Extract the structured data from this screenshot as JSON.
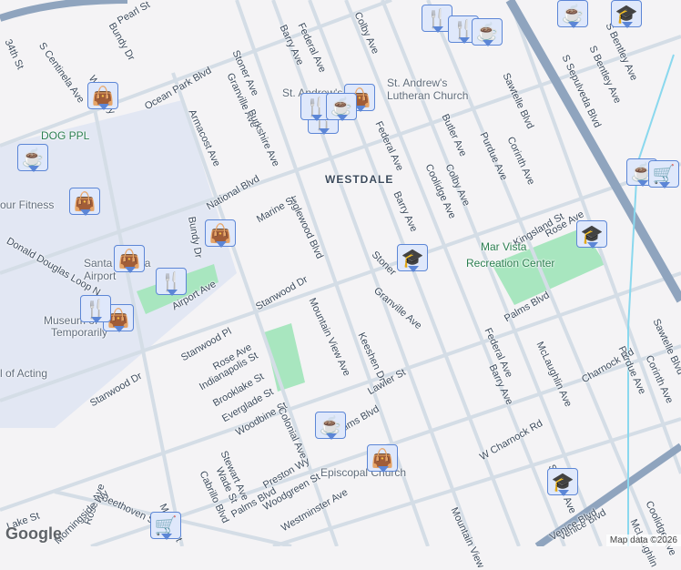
{
  "map": {
    "labels": [
      "Pearl St",
      "34th St",
      "Bundy Dr",
      "S Centinela Ave",
      "Wellesley",
      "Ocean Park Blvd",
      "Stoner Ave",
      "Granville Ave",
      "Barry Ave",
      "Federal Ave",
      "Colby Ave",
      "Armacost Ave",
      "Burkshire Ave",
      "National Blvd",
      "Inglewood Blvd",
      "Marine St",
      "Federal Ave",
      "Barry Ave",
      "Coolidge Ave",
      "Butler Ave",
      "Colby Ave",
      "Purdue Ave",
      "Corinth Ave",
      "Sawtelle Blvd",
      "S Sepulveda Blvd",
      "S Bentley Ave",
      "Kingsland St",
      "Rose Ave",
      "Palms Blvd",
      "McLaughlin Ave",
      "Sawtelle Blvd",
      "Corinth Ave",
      "Purdue Ave",
      "Charnock Rd",
      "Federal Ave",
      "Barry Ave",
      "Granville Ave",
      "Stoner",
      "Keeshen Dr",
      "Lawler St",
      "Mountain View Ave",
      "Stanwood Dr",
      "Bundy Dr",
      "Airport Ave",
      "Donald Douglas Loop N",
      "Stanwood Pl",
      "Rose Ave",
      "Indianapolis St",
      "Brooklake St",
      "Everglade St",
      "Woodbine St",
      "Colonial Ave",
      "Preston Wy",
      "Stewart Ave",
      "Wade St",
      "Cabrillo Blvd",
      "Palms Blvd",
      "Woodgreen St",
      "Westminster Ave",
      "Palms Blvd",
      "W Charnock Rd",
      "S Barry Ave",
      "Mountain View",
      "Venice Blvd",
      "McLaughlin",
      "Coolidge Ave",
      "Beethoven St",
      "Rose Ave",
      "Lake St",
      "Morningside Wy",
      "Stanwood Dr",
      "Moore St",
      "S Bentley Ave",
      "Venice Blvd"
    ],
    "places": [
      "St. Andrew's",
      "Lutheran Church",
      "DOG PPL",
      "WESTDALE",
      "Mar Vista",
      "Recreation Center",
      "Santa Monica",
      "Airport",
      "Museum of",
      "Temporarily",
      "l of Acting",
      "our Fitness",
      "Episcopal Church",
      "St. Andrew's"
    ],
    "attribution": "Map data ©2026",
    "logo": "Google"
  },
  "markers": [
    {
      "type": "shopping",
      "icon": "shopping-bag-icon"
    },
    {
      "type": "shopping",
      "icon": "shopping-bag-icon"
    },
    {
      "type": "shopping",
      "icon": "shopping-bag-icon"
    },
    {
      "type": "shopping",
      "icon": "shopping-bag-icon"
    },
    {
      "type": "shopping",
      "icon": "shopping-bag-icon"
    },
    {
      "type": "shopping",
      "icon": "shopping-bag-icon"
    },
    {
      "type": "shopping",
      "icon": "shopping-bag-icon"
    },
    {
      "type": "restaurant",
      "icon": "fork-knife-icon"
    },
    {
      "type": "restaurant",
      "icon": "fork-knife-icon"
    },
    {
      "type": "restaurant",
      "icon": "fork-knife-icon"
    },
    {
      "type": "restaurant",
      "icon": "fork-knife-icon"
    },
    {
      "type": "restaurant",
      "icon": "fork-knife-icon"
    },
    {
      "type": "restaurant",
      "icon": "fork-knife-icon"
    },
    {
      "type": "cafe",
      "icon": "coffee-cup-icon"
    },
    {
      "type": "cafe",
      "icon": "coffee-cup-icon"
    },
    {
      "type": "cafe",
      "icon": "coffee-cup-icon"
    },
    {
      "type": "cafe",
      "icon": "coffee-cup-icon"
    },
    {
      "type": "cafe",
      "icon": "coffee-cup-icon"
    },
    {
      "type": "cafe",
      "icon": "coffee-cup-icon"
    },
    {
      "type": "school",
      "icon": "graduation-cap-icon"
    },
    {
      "type": "school",
      "icon": "graduation-cap-icon"
    },
    {
      "type": "school",
      "icon": "graduation-cap-icon"
    },
    {
      "type": "school",
      "icon": "graduation-cap-icon"
    },
    {
      "type": "grocery",
      "icon": "shopping-cart-icon"
    },
    {
      "type": "grocery",
      "icon": "shopping-cart-icon"
    }
  ],
  "colors": {
    "background": "#f4f3f5",
    "park": "#a8e6bf",
    "airport": "#e2e7f3",
    "highway": "#8fa4be",
    "road": "#d4dde6",
    "marker_bg": "#dfe8fb",
    "marker_border": "#5c86d6",
    "marker_icon": "#0b3f66"
  }
}
